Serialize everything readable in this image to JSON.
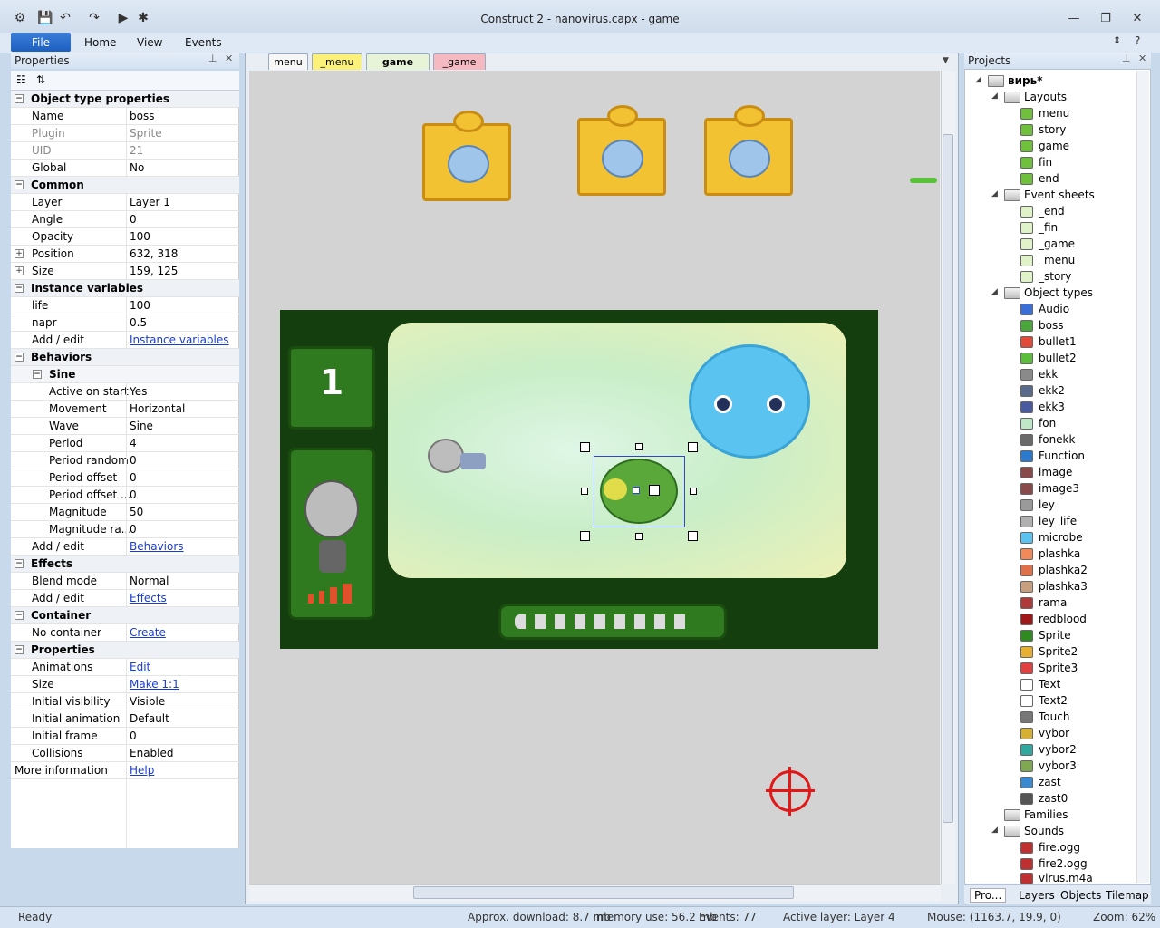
{
  "window": {
    "title": "Construct 2 - nanovirus.capx - game"
  },
  "ribbon": {
    "file": "File",
    "tabs": [
      "Home",
      "View",
      "Events"
    ]
  },
  "properties_panel": {
    "title": "Properties",
    "rows": [
      {
        "type": "cat",
        "label": "Object type properties"
      },
      {
        "k": "Name",
        "v": "boss"
      },
      {
        "k": "Plugin",
        "v": "Sprite",
        "gray": true
      },
      {
        "k": "UID",
        "v": "21",
        "gray": true
      },
      {
        "k": "Global",
        "v": "No"
      },
      {
        "type": "cat",
        "label": "Common"
      },
      {
        "k": "Layer",
        "v": "Layer 1"
      },
      {
        "k": "Angle",
        "v": "0"
      },
      {
        "k": "Opacity",
        "v": "100"
      },
      {
        "k": "Position",
        "v": "632, 318",
        "plus": true
      },
      {
        "k": "Size",
        "v": "159, 125",
        "plus": true
      },
      {
        "type": "cat",
        "label": "Instance variables"
      },
      {
        "k": "life",
        "v": "100"
      },
      {
        "k": "napr",
        "v": "0.5"
      },
      {
        "k": "Add / edit",
        "v": "Instance variables",
        "link": true
      },
      {
        "type": "cat",
        "label": "Behaviors"
      },
      {
        "type": "subcat",
        "label": "Sine"
      },
      {
        "k": "Active on start",
        "v": "Yes",
        "sub": true
      },
      {
        "k": "Movement",
        "v": "Horizontal",
        "sub": true
      },
      {
        "k": "Wave",
        "v": "Sine",
        "sub": true
      },
      {
        "k": "Period",
        "v": "4",
        "sub": true
      },
      {
        "k": "Period random",
        "v": "0",
        "sub": true
      },
      {
        "k": "Period offset",
        "v": "0",
        "sub": true
      },
      {
        "k": "Period offset ...",
        "v": "0",
        "sub": true
      },
      {
        "k": "Magnitude",
        "v": "50",
        "sub": true
      },
      {
        "k": "Magnitude ra...",
        "v": "0",
        "sub": true
      },
      {
        "k": "Add / edit",
        "v": "Behaviors",
        "link": true
      },
      {
        "type": "cat",
        "label": "Effects"
      },
      {
        "k": "Blend mode",
        "v": "Normal"
      },
      {
        "k": "Add / edit",
        "v": "Effects",
        "link": true
      },
      {
        "type": "cat",
        "label": "Container"
      },
      {
        "k": "No container",
        "v": "Create",
        "link": true
      },
      {
        "type": "cat",
        "label": "Properties"
      },
      {
        "k": "Animations",
        "v": "Edit",
        "link": true
      },
      {
        "k": "Size",
        "v": "Make 1:1",
        "link": true
      },
      {
        "k": "Initial visibility",
        "v": "Visible"
      },
      {
        "k": "Initial animation",
        "v": "Default"
      },
      {
        "k": "Initial frame",
        "v": "0"
      },
      {
        "k": "Collisions",
        "v": "Enabled"
      },
      {
        "k": "More information",
        "v": "Help",
        "link": true,
        "top": true
      }
    ]
  },
  "layout_tabs": [
    "menu",
    "_menu",
    "game",
    "_game"
  ],
  "active_tab": "game",
  "hud": {
    "level": "1"
  },
  "projects_panel": {
    "title": "Projects",
    "root": "вирь*",
    "layouts_label": "Layouts",
    "layouts": [
      "menu",
      "story",
      "game",
      "fin",
      "end"
    ],
    "eventsheets_label": "Event sheets",
    "eventsheets": [
      "_end",
      "_fin",
      "_game",
      "_menu",
      "_story"
    ],
    "objecttypes_label": "Object types",
    "objecttypes": [
      "Audio",
      "boss",
      "bullet1",
      "bullet2",
      "ekk",
      "ekk2",
      "ekk3",
      "fon",
      "fonekk",
      "Function",
      "image",
      "image3",
      "ley",
      "ley_life",
      "microbe",
      "plashka",
      "plashka2",
      "plashka3",
      "rama",
      "redblood",
      "Sprite",
      "Sprite2",
      "Sprite3",
      "Text",
      "Text2",
      "Touch",
      "vybor",
      "vybor2",
      "vybor3",
      "zast",
      "zast0"
    ],
    "families_label": "Families",
    "sounds_label": "Sounds",
    "sounds": [
      "fire.ogg",
      "fire2.ogg",
      "virus.m4a"
    ],
    "bottom_tabs": [
      "Pro...",
      "Layers",
      "Objects",
      "Tilemap"
    ]
  },
  "statusbar": {
    "ready": "Ready",
    "download": "Approx. download: 8.7 mb",
    "memory": "memory use: 56.2 mb",
    "events": "Events: 77",
    "layer": "Active layer: Layer 4",
    "mouse": "Mouse: (1163.7, 19.9, 0)",
    "zoom": "Zoom: 62%"
  }
}
